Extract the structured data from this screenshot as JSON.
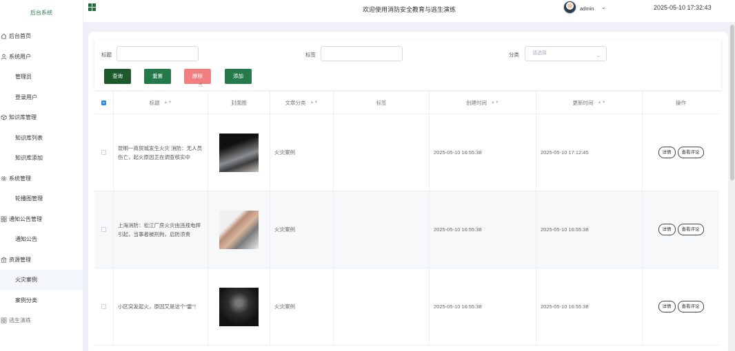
{
  "sidebar": {
    "brand": "后台系统",
    "items": [
      {
        "label": "后台首页",
        "icon": "home-icon",
        "type": "top"
      },
      {
        "label": "系统用户",
        "icon": "user-icon",
        "type": "top"
      },
      {
        "label": "管理员",
        "type": "sub"
      },
      {
        "label": "登录用户",
        "type": "sub"
      },
      {
        "label": "知识库管理",
        "icon": "cube-icon",
        "type": "top"
      },
      {
        "label": "知识库列表",
        "type": "sub"
      },
      {
        "label": "知识库添加",
        "type": "sub"
      },
      {
        "label": "系统管理",
        "icon": "gear-icon",
        "type": "top"
      },
      {
        "label": "轮播图管理",
        "type": "sub"
      },
      {
        "label": "通知公告管理",
        "icon": "grid-icon",
        "type": "top"
      },
      {
        "label": "通知公告",
        "type": "sub"
      },
      {
        "label": "资源管理",
        "icon": "bank-icon",
        "type": "top"
      },
      {
        "label": "火灾案例",
        "type": "sub",
        "active": true
      },
      {
        "label": "案例分类",
        "type": "sub"
      },
      {
        "label": "逃生演练",
        "icon": "grid-icon",
        "type": "top"
      }
    ]
  },
  "header": {
    "welcome": "欢迎使用消防安全教育与逃生演练",
    "user": "admin",
    "datetime": "2025-05-10 17:32:43"
  },
  "filters": {
    "title_label": "标题",
    "tag_label": "标签",
    "category_label": "分类",
    "category_placeholder": "请选择"
  },
  "buttons": {
    "query": "查询",
    "reset": "重置",
    "delete": "删除",
    "add": "添加"
  },
  "table": {
    "headers": [
      "标题",
      "封面图",
      "文章分类",
      "标签",
      "创建时间",
      "更新时间",
      "操作"
    ],
    "rows": [
      {
        "title": "昆明一商贸城发生火灾 消防：无人员伤亡，起火原因正在调查核实中",
        "category": "火灾案例",
        "tag": "",
        "created": "2025-05-10 16:55:38",
        "updated": "2025-05-10 17:12:45"
      },
      {
        "title": "上海消防：松江厂房火灾由违规电焊引起，当事者被刑拘，启防须责",
        "category": "火灾案例",
        "tag": "",
        "created": "2025-05-10 16:55:38",
        "updated": "2025-05-10 16:55:38"
      },
      {
        "title": "小区突发起火，原因又是这个“雷”！",
        "category": "火灾案例",
        "tag": "",
        "created": "2025-05-10 16:55:38",
        "updated": "2025-05-10 16:55:38"
      }
    ],
    "actions": {
      "detail": "详情",
      "comments": "查看评论"
    }
  },
  "colors": {
    "brand_green": "#257a4b",
    "dark_green": "#1c5a2c",
    "delete_red": "#f27f80",
    "checkbox_blue": "#2f88e8"
  }
}
